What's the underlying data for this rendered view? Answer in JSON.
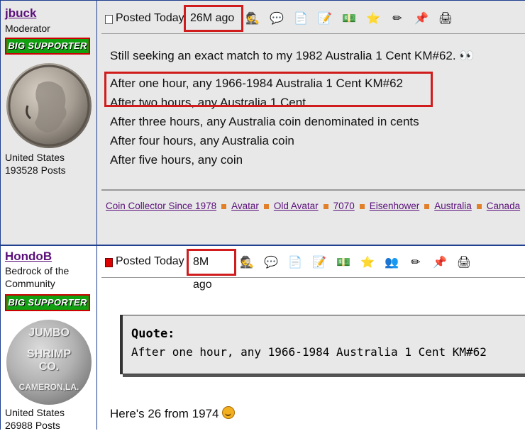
{
  "posts": [
    {
      "username": "jbuck",
      "rank": "Moderator",
      "badge": "BIG SUPPORTER",
      "country": "United States",
      "post_count": "193528 Posts",
      "posted_label": "Posted Today",
      "ago": "26M ago",
      "body_lines": [
        "Still seeking an exact match to my 1982 Australia 1 Cent KM#62. 👀",
        "After one hour, any 1966-1984 Australia 1 Cent KM#62",
        "After two hours, any Australia 1 Cent",
        "After three hours, any Australia coin denominated in cents",
        "After four hours, any Australia coin",
        "After five hours, any coin"
      ],
      "signature_links": [
        "Coin Collector Since 1978",
        "Avatar",
        "Old Avatar",
        "7070",
        "Eisenhower",
        "Australia",
        "Canada"
      ]
    },
    {
      "username": "HondoB",
      "rank_line1": "Bedrock of the",
      "rank_line2": "Community",
      "badge": "BIG SUPPORTER",
      "token_text_top": "JUMBO",
      "token_text_mid": "SHRIMP",
      "token_text_co": "CO.",
      "token_text_bottom": "CAMERON,LA.",
      "country": "United States",
      "post_count": "26988 Posts",
      "posted_label": "Posted Today",
      "ago": "8M ago",
      "quote_title": "Quote:",
      "quote_text": "After one hour, any 1966-1984 Australia 1 Cent KM#62",
      "reply": "Here's 26 from 1974"
    }
  ],
  "icons_post1": [
    "profile-icon",
    "hi-icon",
    "reply-with-quote-icon",
    "edit-icon",
    "send-money-icon",
    "favorite-star-icon",
    "edit-note-icon",
    "report-icon",
    "print-icon"
  ],
  "icons_post2": [
    "profile-icon",
    "hi-icon",
    "reply-with-quote-icon",
    "edit-icon",
    "send-money-icon",
    "favorite-star-icon",
    "buddy-icon",
    "edit-note-icon",
    "report-icon",
    "print-icon"
  ]
}
